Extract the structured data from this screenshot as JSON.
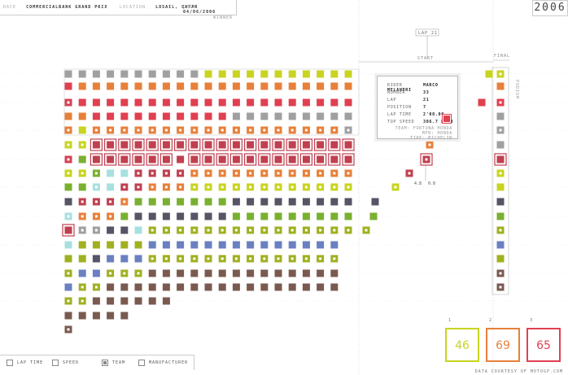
{
  "header": {
    "race_label": "RACE",
    "race_value": "COMMERCIALBANK GRAND PRIX",
    "location_label": "LOCATION",
    "location_value": "LOSAIL, QATAR",
    "date_label": "DATE",
    "date_value": "04/06/2006",
    "year": "2006"
  },
  "chart_data": {
    "type": "grid",
    "title": "",
    "position_axis_label": "WINNER",
    "lap_marker_label": "LAP 21",
    "start_label": "START",
    "final_label": "FINAL",
    "podium_label": "PODIUM",
    "gap_labels": [
      "4.8",
      "0.8"
    ],
    "laps": 22,
    "columns": [
      "#a0a0a0",
      "#e04050",
      "#d34255",
      "#e8803a",
      "#e8803a",
      "#c8d420",
      "#d34255",
      "#9ab828",
      "#e04050",
      "#b03040",
      "#e04050",
      "#e8803a",
      "#9ab828",
      "#7ab030",
      "#555566",
      "#a8e0e0",
      "#9ab828",
      "#a0a0a0",
      "#a0a0a0",
      "#707070"
    ],
    "rows": [
      [
        "#a0a0a0",
        "#a0a0a0",
        "#a0a0a0",
        "#a0a0a0",
        "#a0a0a0",
        "#a0a0a0",
        "#a0a0a0",
        "#a0a0a0",
        "#a0a0a0",
        "#a0a0a0",
        "#c8d420",
        "#c8d420",
        "#c8d420",
        "#c8d420",
        "#c8d420",
        "#c8d420",
        "#c8d420",
        "#c8d420",
        "#c8d420",
        "#c8d420",
        "#c8d420"
      ],
      [
        "#e04050",
        "#e8803a",
        "#e8803a",
        "#e8803a",
        "#e8803a",
        "#e8803a",
        "#e8803a",
        "#e8803a",
        "#e8803a",
        "#e8803a",
        "#e8803a",
        "#e8803a",
        "#e8803a",
        "#e8803a",
        "#e8803a",
        "#e8803a",
        "#e8803a",
        "#e8803a",
        "#e8803a",
        "#e8803a",
        "#e8803a"
      ],
      [
        "#d34255",
        "#e04050",
        "#e04050",
        "#e04050",
        "#e04050",
        "#e04050",
        "#e04050",
        "#e04050",
        "#e04050",
        "#e04050",
        "#e04050",
        "#e04050",
        "#e04050",
        "#e04050",
        "#e04050",
        "#e04050",
        "#e04050",
        "#e04050",
        "#e04050",
        "#e04050",
        "#e04050"
      ],
      [
        "#e8803a",
        "#e8803a",
        "#e04050",
        "#e04050",
        "#e04050",
        "#e04050",
        "#e04050",
        "#e04050",
        "#e04050",
        "#e04050",
        "#e04050",
        "#e04050",
        "#a0a0a0",
        "#a0a0a0",
        "#a0a0a0",
        "#a0a0a0",
        "#a0a0a0",
        "#a0a0a0",
        "#a0a0a0",
        "#a0a0a0",
        "#a0a0a0"
      ],
      [
        "#e8803a",
        "#c8d420",
        "#e8803a",
        "#e8803a",
        "#e8803a",
        "#e8803a",
        "#e8803a",
        "#e8803a",
        "#e8803a",
        "#e8803a",
        "#e8803a",
        "#e8803a",
        "#e8803a",
        "#e8803a",
        "#e8803a",
        "#e8803a",
        "#e8803a",
        "#e8803a",
        "#e8803a",
        "#e8803a",
        "#a0a0a0"
      ],
      [
        "#c8d420",
        "#c8d420",
        "#c04050",
        "#c04050",
        "#c04050",
        "#c04050",
        "#c04050",
        "#c04050",
        "#c04050",
        "#c04050",
        "#c04050",
        "#c04050",
        "#c04050",
        "#c04050",
        "#c04050",
        "#c04050",
        "#c04050",
        "#c04050",
        "#c04050",
        "#c04050",
        "#c04050"
      ],
      [
        "#d34255",
        "#7ab030",
        "#c04050",
        "#c04050",
        "#c04050",
        "#c04050",
        "#c04050",
        "#c04050",
        "#c04050",
        "#c04050",
        "#c04050",
        "#c04050",
        "#c04050",
        "#c04050",
        "#c04050",
        "#c04050",
        "#c04050",
        "#c04050",
        "#c04050",
        "#c04050",
        "#c04050"
      ],
      [
        "#c8d420",
        "#c8d420",
        "#7ab030",
        "#a8e0e0",
        "#a8e0e0",
        "#c04050",
        "#c04050",
        "#c04050",
        "#c04050",
        "#e8803a",
        "#e8803a",
        "#e8803a",
        "#e8803a",
        "#e8803a",
        "#e8803a",
        "#e8803a",
        "#e8803a",
        "#e8803a",
        "#e8803a",
        "#e8803a",
        "#e8803a"
      ],
      [
        "#7ab030",
        "#7ab030",
        "#a8e0e0",
        "#a8e0e0",
        "#c04050",
        "#c04050",
        "#e8803a",
        "#e8803a",
        "#e8803a",
        "#c8d420",
        "#c8d420",
        "#c8d420",
        "#c8d420",
        "#c8d420",
        "#c8d420",
        "#c8d420",
        "#c8d420",
        "#c8d420",
        "#c8d420",
        "#c8d420",
        "#c8d420"
      ],
      [
        "#555566",
        "#c04050",
        "#c04050",
        "#c04050",
        "#e8803a",
        "#7ab030",
        "#7ab030",
        "#7ab030",
        "#7ab030",
        "#7ab030",
        "#7ab030",
        "#7ab030",
        "#555566",
        "#555566",
        "#555566",
        "#555566",
        "#555566",
        "#555566",
        "#555566",
        "#555566",
        "#555566"
      ],
      [
        "#a8e0e0",
        "#e8803a",
        "#e8803a",
        "#e8803a",
        "#7ab030",
        "#555566",
        "#555566",
        "#555566",
        "#555566",
        "#555566",
        "#555566",
        "#555566",
        "#7ab030",
        "#7ab030",
        "#7ab030",
        "#7ab030",
        "#7ab030",
        "#7ab030",
        "#7ab030",
        "#7ab030",
        "#7ab030"
      ],
      [
        "#c04050",
        "#a0a0a0",
        "#a0a0a0",
        "#555566",
        "#555566",
        "#a8e0e0",
        "#a0b020",
        "#a0b020",
        "#a0b020",
        "#a0b020",
        "#a0b020",
        "#a0b020",
        "#a0b020",
        "#a0b020",
        "#a0b020",
        "#a0b020",
        "#a0b020",
        "#a0b020",
        "#a0b020",
        "#a0b020",
        "#a0b020"
      ],
      [
        "#a8e0e0",
        "#a0b020",
        "#a0b020",
        "#a0b020",
        "#a0b020",
        "#a0b020",
        "#6a80c0",
        "#6a80c0",
        "#6a80c0",
        "#6a80c0",
        "#6a80c0",
        "#6a80c0",
        "#6a80c0",
        "#6a80c0",
        "#6a80c0",
        "#6a80c0",
        "#6a80c0",
        "#6a80c0",
        "#6a80c0",
        "#6a80c0"
      ],
      [
        "#a0b020",
        "#a0b020",
        "#555566",
        "#6a80c0",
        "#6a80c0",
        "#6a80c0",
        "#a0b020",
        "#a0b020",
        "#a0b020",
        "#a0b020",
        "#a0b020",
        "#a0b020",
        "#a0b020",
        "#a0b020",
        "#a0b020",
        "#a0b020",
        "#a0b020",
        "#a0b020",
        "#a0b020",
        "#a0b020"
      ],
      [
        "#a0b020",
        "#6a80c0",
        "#6a80c0",
        "#a0b020",
        "#a0b020",
        "#a0b020",
        "#7a5a50",
        "#7a5a50",
        "#7a5a50",
        "#7a5a50",
        "#7a5a50",
        "#7a5a50",
        "#7a5a50",
        "#7a5a50",
        "#7a5a50",
        "#7a5a50",
        "#7a5a50",
        "#7a5a50",
        "#7a5a50",
        "#7a5a50"
      ],
      [
        "#6a80c0",
        "#a0b020",
        "#a0b020",
        "#7a5a50",
        "#7a5a50",
        "#7a5a50",
        "#7a5a50",
        "#7a5a50",
        "#7a5a50",
        "#7a5a50",
        "#7a5a50",
        "#7a5a50",
        "#7a5a50",
        "#7a5a50",
        "#7a5a50",
        "#7a5a50",
        "#7a5a50",
        "#7a5a50",
        "#7a5a50",
        "#7a5a50"
      ],
      [
        "#a0b020",
        "#a0b020",
        "#7a5a50",
        "#7a5a50",
        "#7a5a50",
        "#7a5a50",
        "#7a5a50",
        "#7a5a50"
      ],
      [
        "#7a5a50",
        "#7a5a50",
        "#7a5a50",
        "#7a5a50",
        "#7a5a50"
      ],
      [
        "#7a5a50"
      ]
    ],
    "hollow": [
      [],
      [],
      [
        0
      ],
      [],
      [
        0,
        2,
        3,
        4,
        5,
        6,
        7,
        8,
        9,
        10,
        11,
        12,
        13,
        14,
        15,
        16,
        17,
        18,
        19,
        20
      ],
      [
        0,
        1
      ],
      [
        0
      ],
      [
        0,
        1,
        2,
        5,
        6,
        7,
        8,
        9,
        10,
        11,
        12,
        13,
        14,
        15,
        16,
        17,
        18,
        19,
        20
      ],
      [
        2,
        4,
        5,
        6,
        7,
        8,
        9,
        10,
        11,
        12,
        13,
        14,
        15,
        16,
        17,
        18,
        19,
        20
      ],
      [
        1,
        2,
        3,
        4
      ],
      [
        0,
        1,
        2,
        3
      ],
      [
        1,
        2,
        6,
        7,
        8,
        9,
        10,
        11,
        12,
        13,
        14,
        15,
        16,
        17,
        18,
        19,
        20
      ],
      [],
      [
        6,
        7,
        8,
        9,
        10,
        11,
        12,
        13,
        14,
        15,
        16,
        17,
        18,
        19
      ],
      [
        0,
        3,
        4,
        5
      ],
      [
        1,
        2
      ],
      [
        0,
        1
      ],
      [],
      [
        0
      ]
    ],
    "outlined": [
      [
        5,
        2
      ],
      [
        5,
        3
      ],
      [
        5,
        4
      ],
      [
        5,
        5
      ],
      [
        5,
        6
      ],
      [
        5,
        7
      ],
      [
        5,
        8
      ],
      [
        5,
        9
      ],
      [
        5,
        10
      ],
      [
        5,
        11
      ],
      [
        5,
        12
      ],
      [
        5,
        13
      ],
      [
        5,
        14
      ],
      [
        5,
        15
      ],
      [
        5,
        16
      ],
      [
        5,
        17
      ],
      [
        5,
        18
      ],
      [
        5,
        19
      ],
      [
        5,
        20
      ],
      [
        6,
        2
      ],
      [
        6,
        3
      ],
      [
        6,
        4
      ],
      [
        6,
        5
      ],
      [
        6,
        6
      ],
      [
        6,
        7
      ],
      [
        6,
        9
      ],
      [
        6,
        10
      ],
      [
        6,
        11
      ],
      [
        6,
        12
      ],
      [
        6,
        13
      ],
      [
        6,
        14
      ],
      [
        6,
        15
      ],
      [
        6,
        16
      ],
      [
        6,
        17
      ],
      [
        6,
        18
      ],
      [
        6,
        19
      ],
      [
        6,
        20
      ],
      [
        11,
        0
      ]
    ],
    "final_column": [
      "#c8d420",
      "#e8803a",
      "#e04050",
      "#a0a0a0",
      "#a0a0a0",
      "#a0a0a0",
      "#c04050",
      "#c8d420",
      "#c8d420",
      "#555566",
      "#7ab030",
      "#a0b020",
      "#6a80c0",
      "#a0b020",
      "#7a5a50",
      "#7a5a50"
    ]
  },
  "tooltip": {
    "rider_k": "RIDER",
    "rider_v": "MARCO MELANDRI",
    "number_k": "NUMBER",
    "number_v": "33",
    "lap_k": "LAP",
    "lap_v": "21",
    "position_k": "POSITION",
    "position_v": "7",
    "laptime_k": "LAP TIME",
    "laptime_v": "2'00.00",
    "speed_k": "TOP SPEED",
    "speed_v": "306.7 KM/H",
    "team": "TEAM: FORTUNA HONDA",
    "mfr": "MFR: HONDA",
    "tire": "TIRE: MICHELIN",
    "color": "#e04050"
  },
  "footer": {
    "laptime": "LAP TIME",
    "speed": "SPEED",
    "team": "TEAM",
    "manufacturer": "MANUFACTURER",
    "credit": "DATA COURTESY OF MOTOGP.COM"
  },
  "stats": [
    {
      "value": "46",
      "pos": "1",
      "color": "#c8d420"
    },
    {
      "value": "69",
      "pos": "2",
      "color": "#e8803a"
    },
    {
      "value": "65",
      "pos": "3",
      "color": "#e04050"
    }
  ]
}
